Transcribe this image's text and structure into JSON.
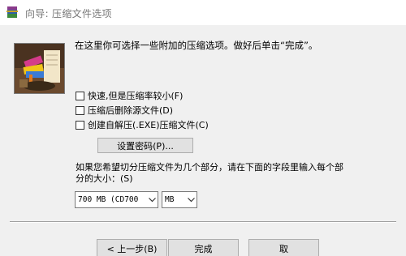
{
  "window": {
    "title": "向导: 压缩文件选项"
  },
  "intro_text": "在这里你可选择一些附加的压缩选项。做好后单击“完成”。",
  "options": [
    {
      "label": "快速,但是压缩率较小(F)",
      "checked": false
    },
    {
      "label": "压缩后删除源文件(D)",
      "checked": false
    },
    {
      "label": "创建自解压(.EXE)压缩文件(C)",
      "checked": false
    }
  ],
  "password_button": "设置密码(P)...",
  "split_text": "如果您希望切分压缩文件为几个部分，请在下面的字段里输入每个部分的大小：(S)",
  "volume_size": {
    "value": "700 MB  (CD700"
  },
  "volume_unit": {
    "value": "MB"
  },
  "buttons": {
    "back": "< 上一步(B)",
    "finish": "完成",
    "cancel": "取"
  },
  "icons": {
    "app": "winrar-icon",
    "logo": "winrar-wizard-logo",
    "dropdown": "chevron-down-icon"
  }
}
